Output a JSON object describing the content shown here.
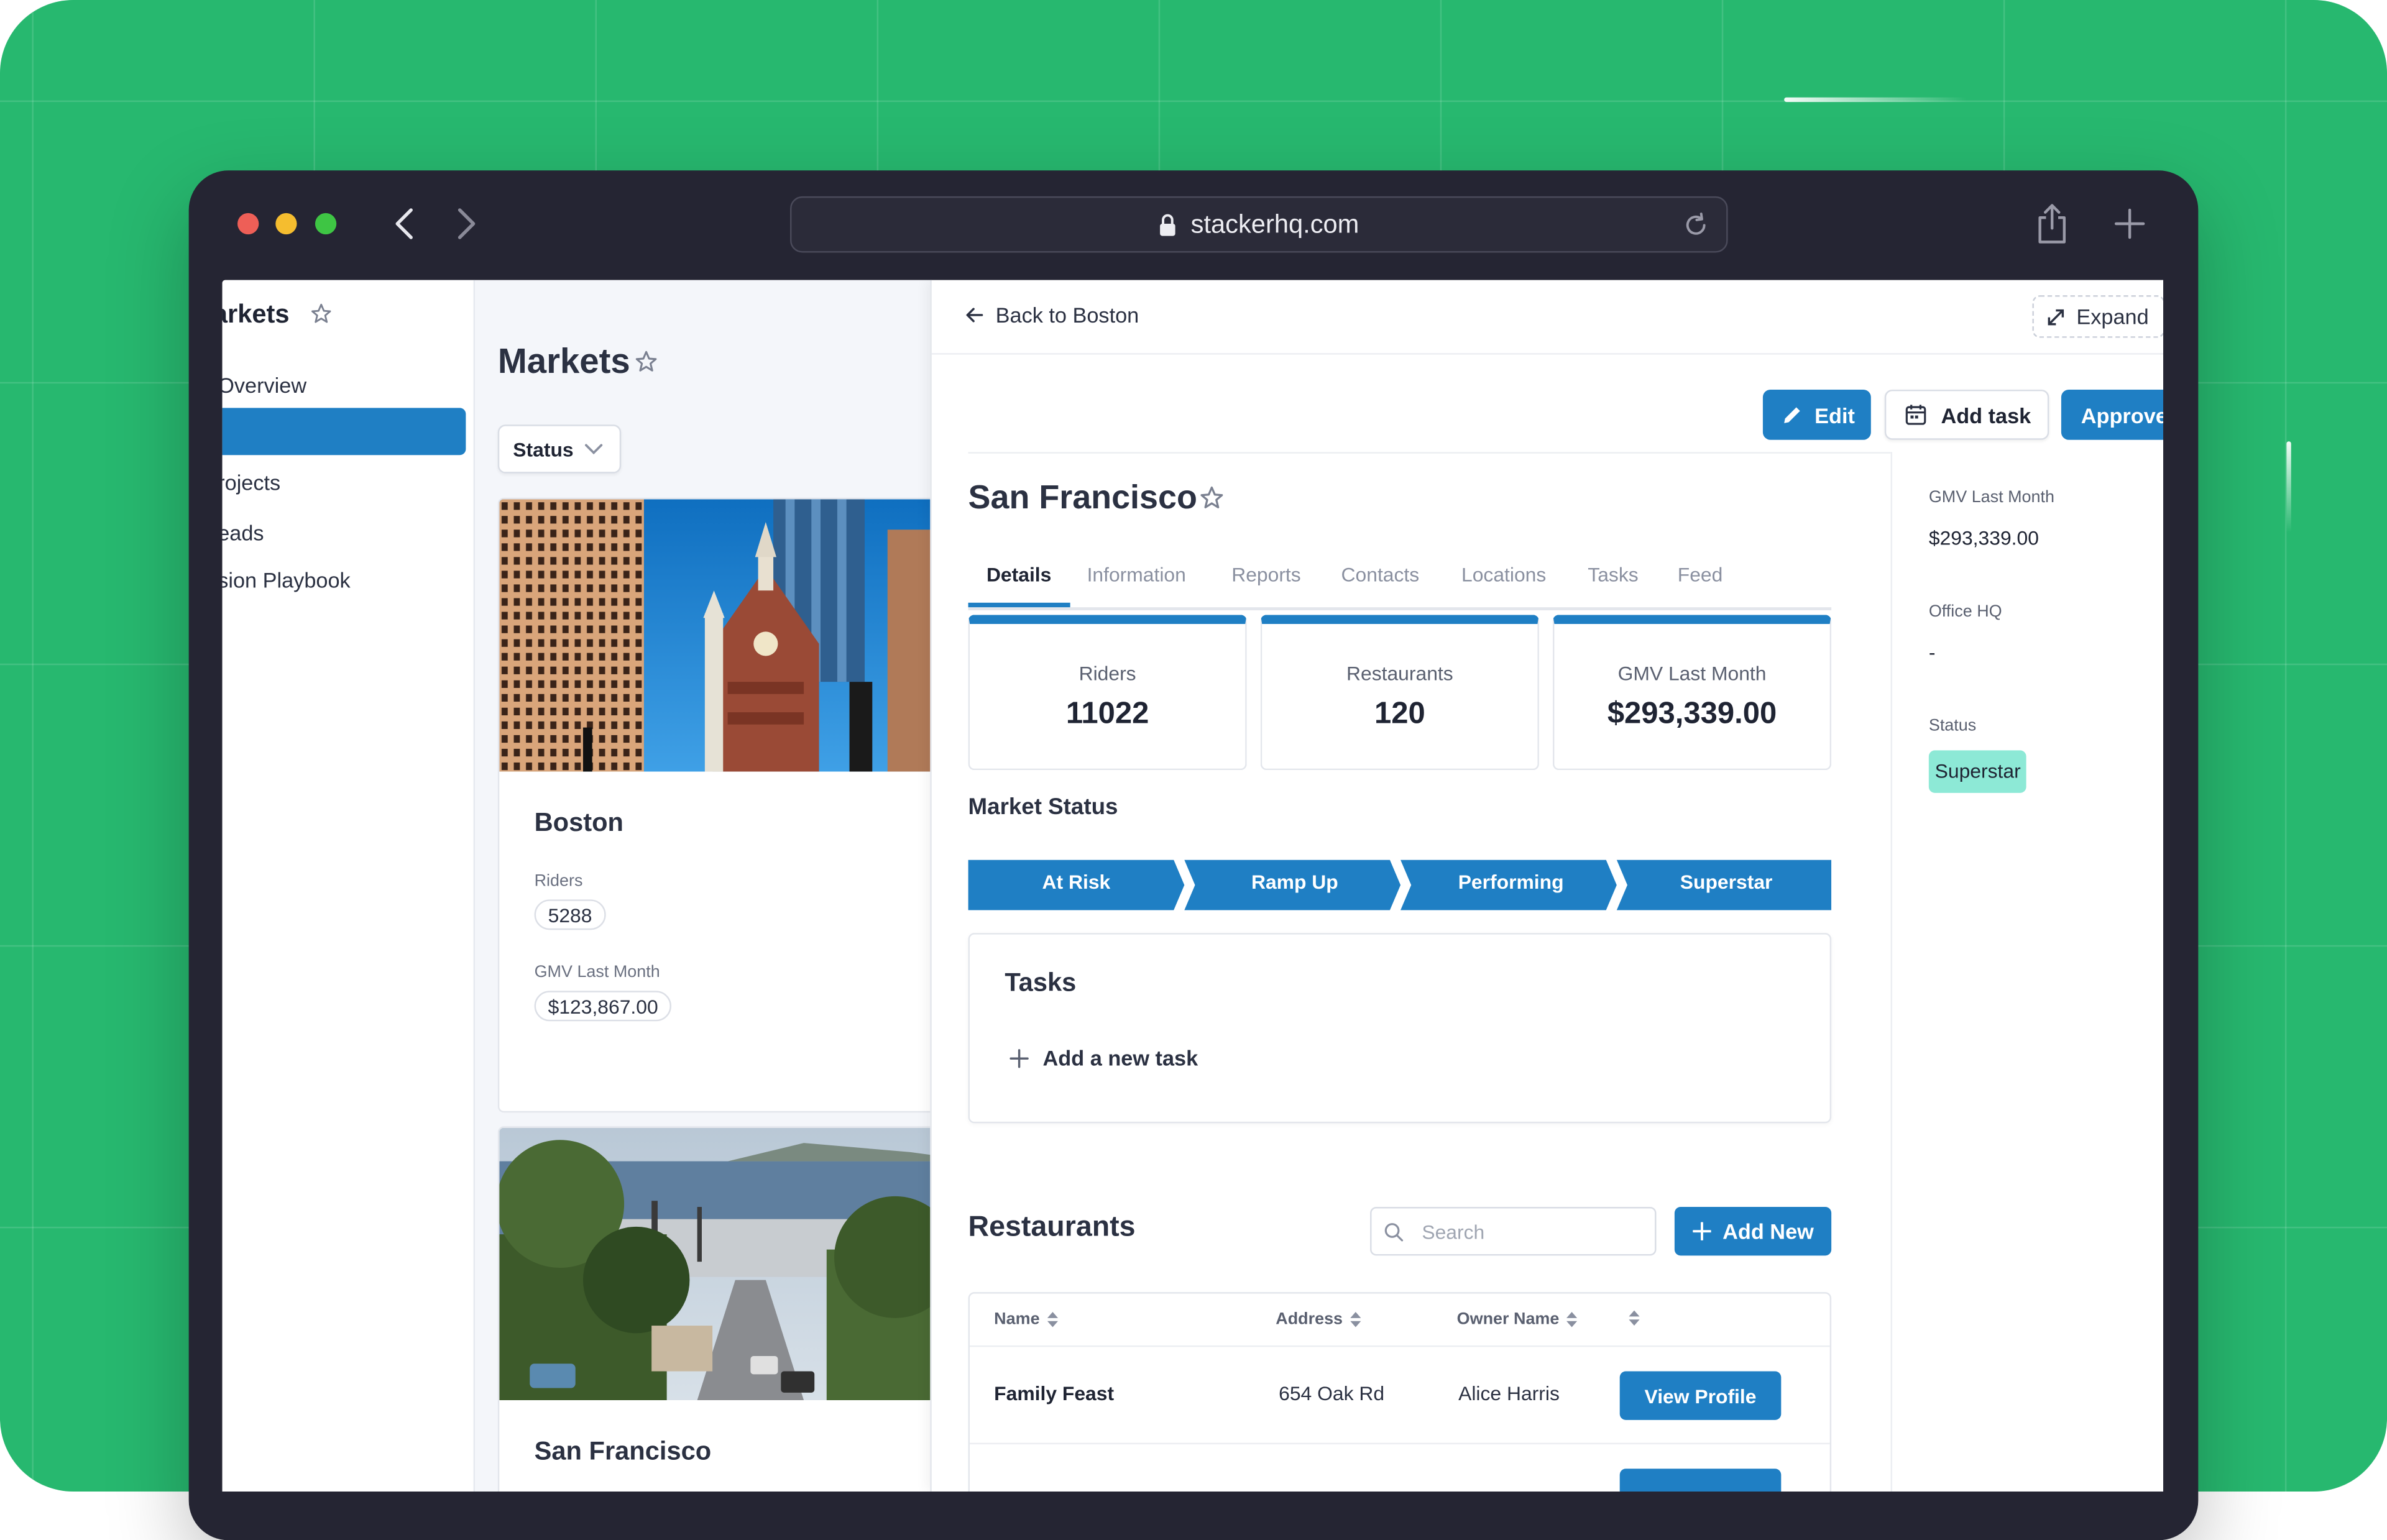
{
  "browser": {
    "url": "stackerhq.com",
    "traffic_lights": {
      "close": "#ee5f57",
      "minimize": "#f5bd2f",
      "maximize": "#3ec544"
    }
  },
  "sidebar": {
    "title": "arkets",
    "items": [
      {
        "label": "Overview"
      },
      {
        "label": ""
      },
      {
        "label": "rojects"
      },
      {
        "label": "eads"
      },
      {
        "label": "sion Playbook"
      }
    ]
  },
  "markets_list": {
    "title": "Markets",
    "status_filter": "Status",
    "cards": [
      {
        "name": "Boston",
        "riders_label": "Riders",
        "riders": "5288",
        "gmv_label": "GMV Last Month",
        "gmv": "$123,867.00"
      },
      {
        "name": "San Francisco"
      }
    ]
  },
  "detail": {
    "back_label": "Back to Boston",
    "expand_label": "Expand",
    "buttons": {
      "edit": "Edit",
      "add_task": "Add task",
      "approve": "Approve"
    },
    "title": "San Francisco",
    "tabs": [
      "Details",
      "Information",
      "Reports",
      "Contacts",
      "Locations",
      "Tasks",
      "Feed"
    ],
    "stats": [
      {
        "label": "Riders",
        "value": "11022"
      },
      {
        "label": "Restaurants",
        "value": "120"
      },
      {
        "label": "GMV Last Month",
        "value": "$293,339.00"
      }
    ],
    "market_status": {
      "title": "Market Status",
      "stages": [
        "At Risk",
        "Ramp Up",
        "Performing",
        "Superstar"
      ]
    },
    "tasks": {
      "title": "Tasks",
      "add_label": "Add a new task"
    },
    "restaurants": {
      "title": "Restaurants",
      "search_placeholder": "Search",
      "add_new": "Add New",
      "columns": [
        "Name",
        "Address",
        "Owner Name",
        ""
      ],
      "rows": [
        {
          "name": "Family Feast",
          "address": "654 Oak Rd",
          "owner": "Alice Harris",
          "action": "View Profile"
        }
      ]
    },
    "side": {
      "gmv_label": "GMV Last Month",
      "gmv_value": "$293,339.00",
      "office_label": "Office HQ",
      "office_value": "-",
      "status_label": "Status",
      "status_value": "Superstar"
    }
  },
  "colors": {
    "background": "#27b86f",
    "accent": "#1f7fc4",
    "badge": "#8de9d6",
    "device": "#252533"
  }
}
